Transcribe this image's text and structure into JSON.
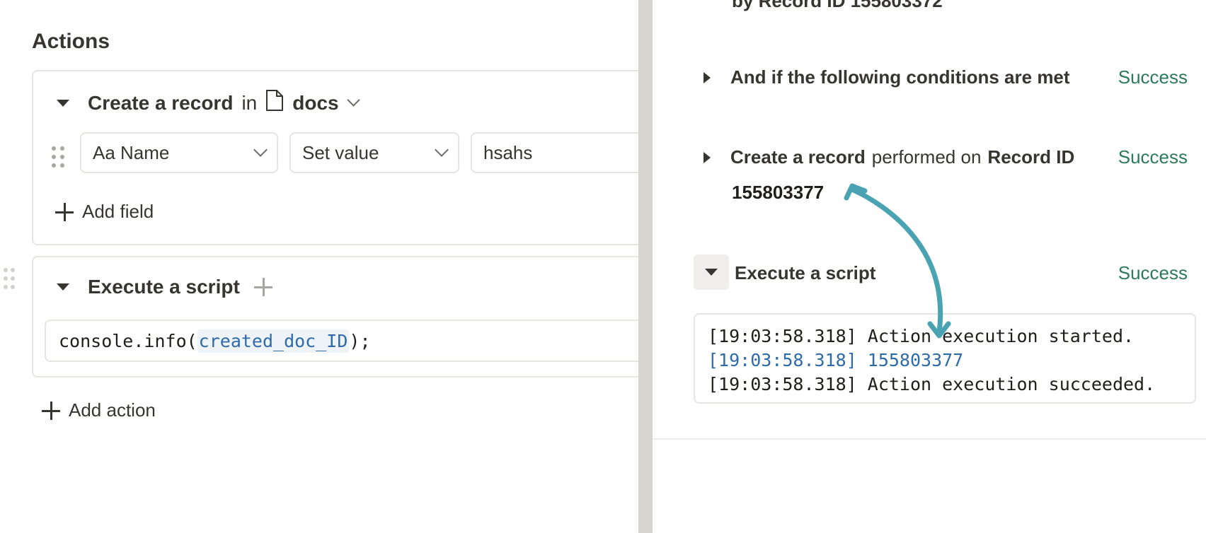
{
  "left": {
    "actions_title": "Actions",
    "action1": {
      "title_bold": "Create a record",
      "title_in": "in",
      "db_name": "docs",
      "field_select": "Aa Name",
      "op_select": "Set value",
      "value_input": "hsahs",
      "add_field_label": "Add field"
    },
    "action2": {
      "title": "Execute a script",
      "code_prefix": "console.info(",
      "code_var": "created_doc_ID",
      "code_suffix": ");"
    },
    "add_action_label": "Add action"
  },
  "right": {
    "top_cut_text": "by Record ID 155803372",
    "step1": {
      "label": "And if the following conditions are met",
      "status": "Success"
    },
    "step2": {
      "label_bold": "Create a record",
      "label_mid": "performed on",
      "label_bold2": "Record ID",
      "record_id": "155803377",
      "status": "Success"
    },
    "step3": {
      "label": "Execute a script",
      "status": "Success"
    },
    "log_lines": [
      "[19:03:58.318] Action execution started.",
      "[19:03:58.318] 155803377",
      "[19:03:58.318] Action execution succeeded."
    ]
  },
  "colors": {
    "success": "#2d7a5a",
    "accent_blue": "#2f6ba8",
    "arrow": "#4aa3b3",
    "divider": "#d6d4cf"
  }
}
